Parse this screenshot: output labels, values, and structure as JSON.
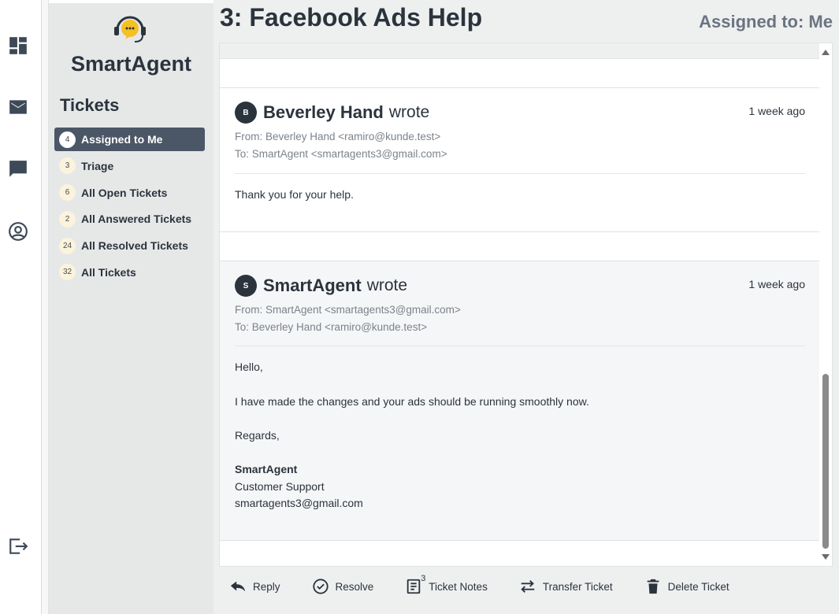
{
  "ticket": {
    "title": "3: Facebook Ads Help",
    "assigned_label": "Assigned to: Me"
  },
  "brand": {
    "name": "SmartAgent"
  },
  "sidebar": {
    "section_title": "Tickets",
    "items": [
      {
        "count": "4",
        "label": "Assigned to Me",
        "active": true
      },
      {
        "count": "3",
        "label": "Triage"
      },
      {
        "count": "6",
        "label": "All Open Tickets"
      },
      {
        "count": "2",
        "label": "All Answered Tickets"
      },
      {
        "count": "24",
        "label": "All Resolved Tickets"
      },
      {
        "count": "32",
        "label": "All Tickets"
      }
    ]
  },
  "messages": [
    {
      "avatar": "B",
      "sender": "Beverley Hand",
      "wrote": "wrote",
      "time": "1 week ago",
      "from": "From: Beverley Hand <ramiro@kunde.test>",
      "to": "To: SmartAgent <smartagents3@gmail.com>",
      "body": [
        "Thank you for your help."
      ]
    },
    {
      "avatar": "S",
      "sender": "SmartAgent",
      "wrote": "wrote",
      "time": "1 week ago",
      "from": "From: SmartAgent <smartagents3@gmail.com>",
      "to": "To: Beverley Hand <ramiro@kunde.test>",
      "body": [
        "Hello,",
        "I have made the changes and your ads should be running smoothly now.",
        "Regards,",
        "SmartAgent",
        "Customer Support",
        "smartagents3@gmail.com"
      ]
    }
  ],
  "actions": {
    "reply": "Reply",
    "resolve": "Resolve",
    "notes": "Ticket Notes",
    "notes_count": "3",
    "transfer": "Transfer Ticket",
    "delete": "Delete Ticket"
  },
  "rail_icons": [
    "dashboard-icon",
    "mail-icon",
    "chat-icon",
    "account-icon",
    "logout-icon"
  ],
  "colors": {
    "active_nav": "#4b5666",
    "sidebar_bg": "#e6e8e8",
    "text_dark": "#2b333d",
    "badge_bg": "#fbf3dc",
    "logo_yellow": "#f5c022"
  }
}
